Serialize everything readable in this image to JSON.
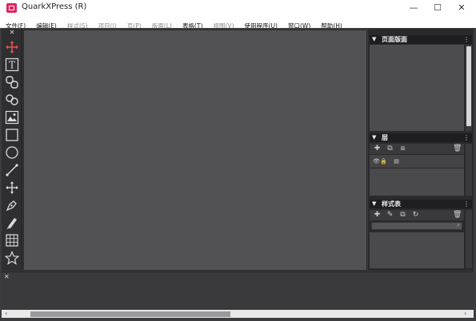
{
  "window": {
    "title": "QuarkXPress (R)",
    "minimize": "—",
    "maximize": "☐",
    "close": "✕"
  },
  "menu": [
    {
      "label": "文件(F)",
      "enabled": true
    },
    {
      "label": "编辑(E)",
      "enabled": true
    },
    {
      "label": "样式(S)",
      "enabled": false
    },
    {
      "label": "项目(I)",
      "enabled": false
    },
    {
      "label": "页(P)",
      "enabled": false
    },
    {
      "label": "版面(L)",
      "enabled": false
    },
    {
      "label": "表格(T)",
      "enabled": true
    },
    {
      "label": "视图(V)",
      "enabled": false
    },
    {
      "label": "使用程序(U)",
      "enabled": true
    },
    {
      "label": "窗口(W)",
      "enabled": true
    },
    {
      "label": "帮助(H)",
      "enabled": true
    }
  ],
  "tools": {
    "close": "✕",
    "items": [
      "move-tool",
      "text-content-tool",
      "picture-link-tool",
      "text-linking-tool",
      "picture-content-tool",
      "rectangle-box-tool",
      "oval-box-tool",
      "line-tool",
      "pan-tool",
      "pen-tool",
      "composition-tool",
      "table-tool",
      "star-tool"
    ]
  },
  "palettes": {
    "page_layout": {
      "title": "页面版面",
      "menu": "⋮",
      "collapse": "▼"
    },
    "layers": {
      "title": "层",
      "menu": "⋮",
      "collapse": "▼"
    },
    "style_sheets": {
      "title": "样式表",
      "menu": "⋮",
      "collapse": "▼"
    }
  },
  "bottom": {
    "close": "✕"
  },
  "scroll": {
    "left": "‹",
    "right": "›"
  }
}
